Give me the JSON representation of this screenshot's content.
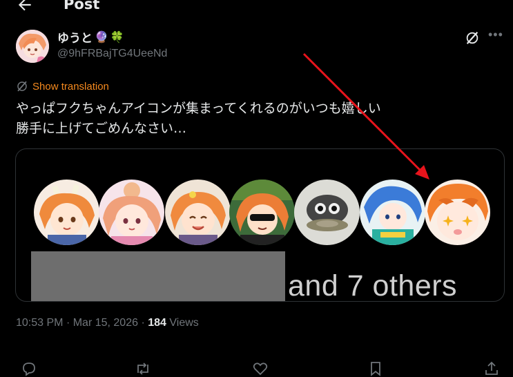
{
  "header": {
    "title": "Post",
    "back_icon": "arrow-left-icon"
  },
  "author": {
    "display_name": "ゆうと",
    "name_emojis": [
      "🔮",
      "🍀"
    ],
    "handle": "@9hFRBajTG4UeeNd"
  },
  "tweet": {
    "show_translation_label": "Show translation",
    "line1": "やっぱフクちゃんアイコンが集まってくれるのがいつも嬉しい",
    "line2": "勝手に上げてごめんなさい…"
  },
  "media": {
    "others_text": "and 7 others",
    "avatars": [
      "orange-hair-horns",
      "pink-hair-bun",
      "orange-hair-laughing",
      "sunglasses-character",
      "gray-cat",
      "blue-hair-character",
      "orange-hair-sparkle-eyes"
    ]
  },
  "meta": {
    "time": "10:53 PM",
    "separator": "·",
    "date": "Mar 15, 2026",
    "views_count": "184",
    "views_label": "Views"
  },
  "colors": {
    "background": "#000000",
    "text": "#e7e9ea",
    "muted": "#71767b",
    "translation": "#f68a1e",
    "annotation_arrow": "#e8141c"
  }
}
